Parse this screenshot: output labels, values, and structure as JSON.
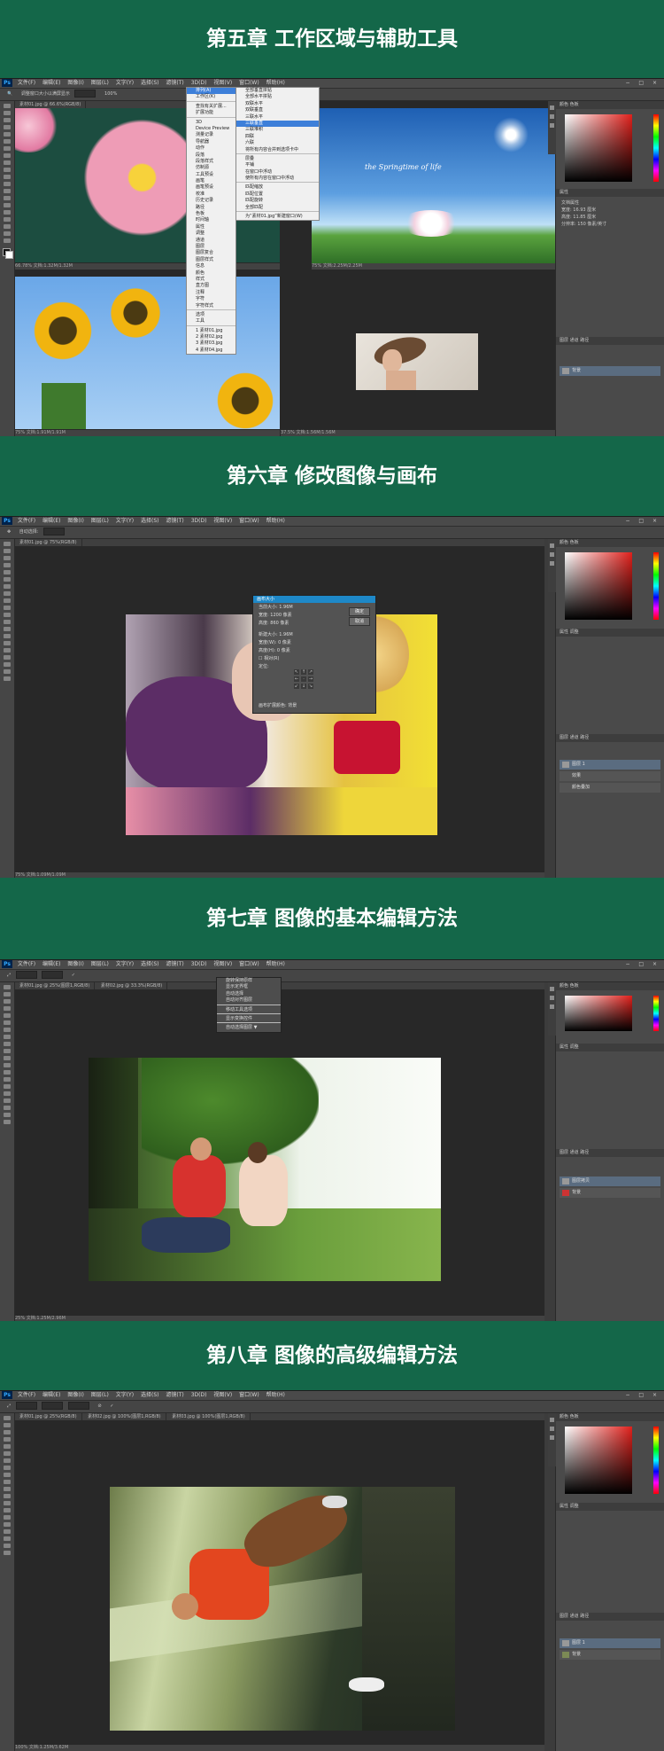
{
  "banners": [
    "第五章 工作区域与辅助工具",
    "第六章 修改图像与画布",
    "第七章 图像的基本编辑方法",
    "第八章  图像的高级编辑方法"
  ],
  "ps": {
    "logo": "Ps",
    "menu": [
      "文件(F)",
      "编辑(E)",
      "图像(I)",
      "图层(L)",
      "文字(Y)",
      "选择(S)",
      "滤镜(T)",
      "3D(D)",
      "视图(V)",
      "窗口(W)",
      "帮助(H)"
    ],
    "window_controls": "− □ ×",
    "panel_color_tab": "颜色",
    "panel_swatch_tab": "色板",
    "panel_props_tab": "属性",
    "panel_adjust_tab": "调整",
    "panel_layers_tab": "图层",
    "panel_channels_tab": "通道",
    "panel_paths_tab": "路径"
  },
  "s1": {
    "options_text": "调整窗口大小以满屏显示",
    "options_zoom": "100%",
    "tabs": [
      "素材01.jpg @ 66.6%(RGB/8)",
      "素材02.jpg @ 50%(RGB/8)"
    ],
    "status_left": "66.78%    文档:1.32M/1.32M",
    "status_mid": "75%    文档:2.25M/2.25M",
    "status_bottom_left": "75%    文档:1.91M/1.91M",
    "status_bottom_mid": "37.5%    文档:1.56M/1.56M",
    "photo_text": "the Springtime of life",
    "window_menu": [
      "排列(A)",
      "工作区(K)",
      "",
      "查找有关扩展...",
      "扩展功能",
      "",
      "3D",
      "Device Preview",
      "测量记录",
      "导航器",
      "动作",
      "段落",
      "段落样式",
      "仿制源",
      "工具预设",
      "画笔",
      "画笔预设",
      "校准",
      "历史记录",
      "路径",
      "色板",
      "时间轴",
      "属性",
      "调整",
      "通道",
      "图层",
      "图层复合",
      "图层样式",
      "信息",
      "颜色",
      "样式",
      "直方图",
      "注释",
      "字符",
      "字符样式",
      "",
      "选项",
      "工具",
      "",
      "1 素材01.jpg",
      "2 素材02.jpg",
      "3 素材03.jpg",
      "4 素材04.jpg"
    ],
    "arrange_menu": [
      "全部垂直拼贴",
      "全部水平拼贴",
      "双联水平",
      "双联垂直",
      "三联水平",
      "三联垂直",
      "三联堆积",
      "四联",
      "六联",
      "将所有内容合并到选项卡中",
      "",
      "层叠",
      "平铺",
      "在窗口中浮动",
      "使所有内容在窗口中浮动",
      "",
      "匹配缩放",
      "匹配位置",
      "匹配旋转",
      "全部匹配",
      "",
      "为“素材01.jpg”新建窗口(W)"
    ],
    "props_lines": [
      "文档属性",
      "宽度: 16.93 厘米",
      "高度: 11.85 厘米",
      "分辨率: 150 像素/英寸"
    ],
    "layer_name": "背景"
  },
  "s2": {
    "options_text": "自动选择:",
    "tabs": [
      "素材01.jpg @ 75%(RGB/8)"
    ],
    "status": "75%    文档:1.09M/1.09M",
    "dialog_title": "画布大小",
    "dialog_lines": [
      "当前大小: 1.96M",
      "宽度: 1200 像素",
      "高度: 860 像素",
      "新建大小: 1.96M",
      "宽度(W): 0  像素",
      "高度(H): 0  像素",
      "☐ 相对(R)",
      "定位:",
      "画布扩展颜色: 背景"
    ],
    "ok": "确定",
    "cancel": "取消",
    "layers": [
      "图层 1",
      "效果",
      "颜色叠加"
    ]
  },
  "s3": {
    "tabs": [
      "素材01.jpg @ 25%(图层1,RGB/8)",
      "素材02.jpg @ 33.3%(RGB/8)"
    ],
    "status": "25%    文档:1.25M/2.96M",
    "menu": [
      "旋转保持原样",
      "显示定界框",
      "自动选择",
      "自动对齐图层",
      "",
      "移动工具选项",
      "",
      "显示变换控件",
      "",
      "自动选择图层 ▼"
    ],
    "layers": [
      "图层拷贝",
      "背景"
    ]
  },
  "s4": {
    "tabs": [
      "素材01.jpg @ 25%(RGB/8)",
      "素材02.jpg @ 100%(图层1,RGB/8)",
      "素材03.jpg @ 100%(图层1,RGB/8)"
    ],
    "status": "100%    文档:1.25M/3.62M",
    "layers": [
      "图层 1",
      "背景"
    ]
  }
}
